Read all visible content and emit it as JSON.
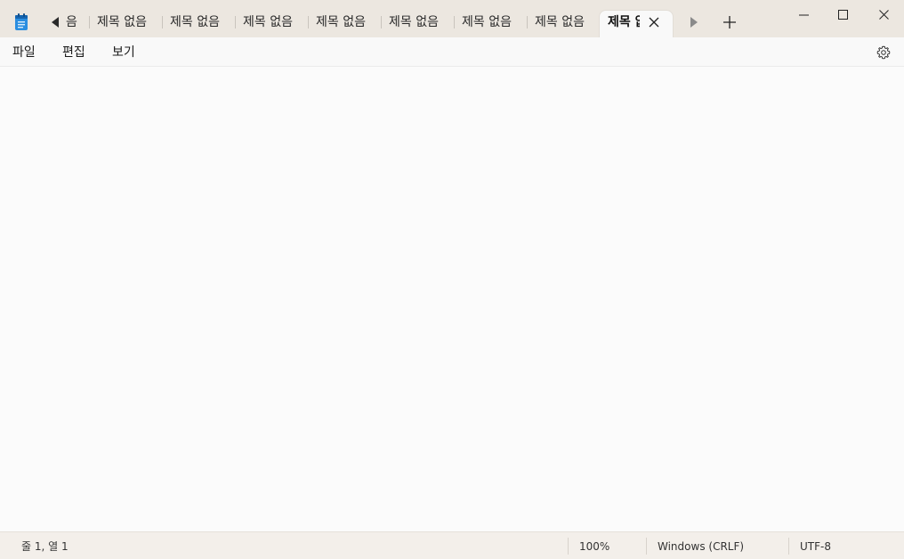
{
  "tabs": {
    "fragment": "음",
    "items": [
      {
        "label": "제목 없음"
      },
      {
        "label": "제목 없음"
      },
      {
        "label": "제목 없음"
      },
      {
        "label": "제목 없음"
      },
      {
        "label": "제목 없음"
      },
      {
        "label": "제목 없음"
      },
      {
        "label": "제목 없음"
      }
    ],
    "active": {
      "label": "제목 없음"
    }
  },
  "menu": {
    "file": "파일",
    "edit": "편집",
    "view": "보기"
  },
  "status": {
    "position": "줄 1, 열 1",
    "zoom": "100%",
    "line_ending": "Windows (CRLF)",
    "encoding": "UTF-8"
  },
  "icons": {
    "app": "notepad-icon",
    "scroll_left": "triangle-left-icon",
    "scroll_right": "triangle-right-icon",
    "new_tab": "plus-icon",
    "tab_close": "close-icon",
    "minimize": "minimize-icon",
    "maximize": "maximize-icon",
    "window_close": "close-icon",
    "settings": "gear-icon"
  },
  "colors": {
    "titlebar": "#ece7e0",
    "editor": "#fbfbfb",
    "statusbar": "#f3efea",
    "app_icon": "#1f7ccb"
  }
}
